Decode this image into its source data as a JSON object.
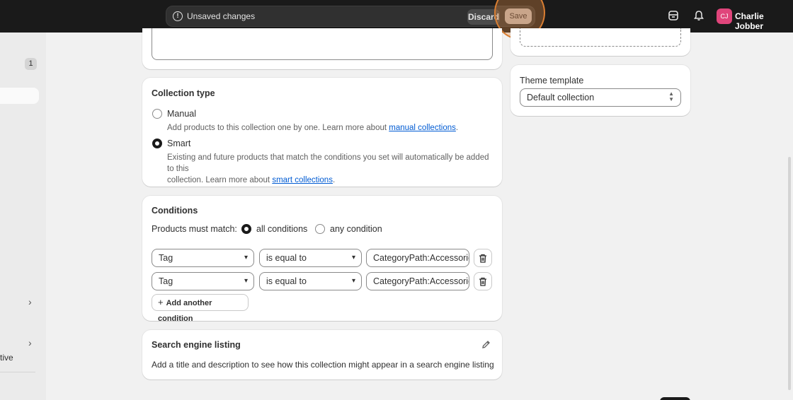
{
  "topbar": {
    "unsaved_text": "Unsaved changes",
    "discard_label": "Discard",
    "save_label": "Save",
    "user_initials": "CJ",
    "user_name": "Charlie Jobber"
  },
  "sidebar": {
    "count": "1",
    "partial_item_text": "tive"
  },
  "collection_type": {
    "title": "Collection type",
    "manual": {
      "label": "Manual",
      "help_prefix": "Add products to this collection one by one. Learn more about ",
      "help_link": "manual collections",
      "help_suffix": "."
    },
    "smart": {
      "label": "Smart",
      "help_line1": "Existing and future products that match the conditions you set will automatically be added to this",
      "help_line2_prefix": "collection. Learn more about ",
      "help_link": "smart collections",
      "help_suffix": "."
    },
    "selected": "Smart"
  },
  "conditions": {
    "title": "Conditions",
    "match_label": "Products must match:",
    "all_label": "all conditions",
    "any_label": "any condition",
    "selected": "all conditions",
    "rows": [
      {
        "field": "Tag",
        "operator": "is equal to",
        "value": "CategoryPath:Accessories"
      },
      {
        "field": "Tag",
        "operator": "is equal to",
        "value": "CategoryPath:Accessories"
      }
    ],
    "add_label": "Add another condition"
  },
  "seo": {
    "title": "Search engine listing",
    "description": "Add a title and description to see how this collection might appear in a search engine listing"
  },
  "theme": {
    "label": "Theme template",
    "value": "Default collection"
  },
  "colors": {
    "accent_highlight": "#d97e32",
    "avatar": "#e0457b",
    "link": "#005bd3"
  }
}
